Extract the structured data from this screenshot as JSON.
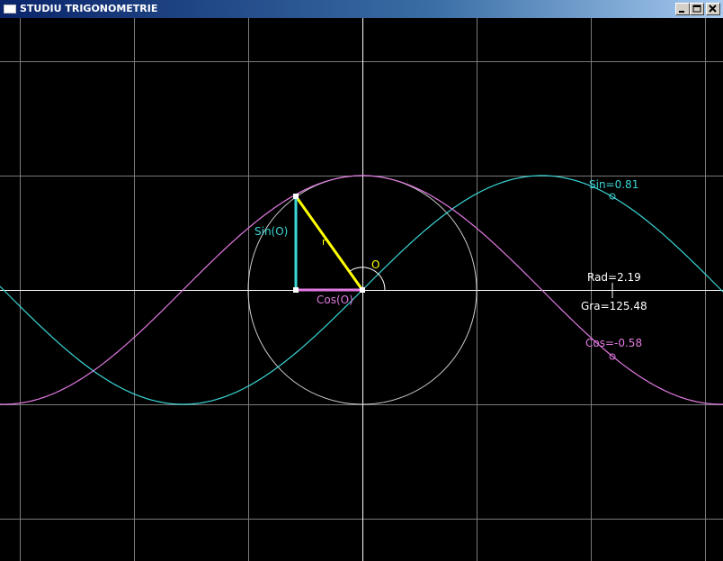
{
  "window": {
    "title": "STUDIU TRIGONOMETRIE"
  },
  "colors": {
    "sin": "#3cd6d6",
    "cos": "#e27ae2",
    "radius": "#ffff00",
    "axes": "#ffffff",
    "grid": "#7a7a7a",
    "circle": "#d0d0d0"
  },
  "labels": {
    "sin_value": "Sin=0.81",
    "cos_value": "Cos=-0.58",
    "rad": "Rad=2.19",
    "gra": "Gra=125.48",
    "sin_o": "Sin(O)",
    "cos_o": "Cos(O)",
    "radius_r": "r",
    "angle_o": "O"
  },
  "state": {
    "angle_rad": 2.19,
    "angle_deg": 125.48,
    "sin": 0.81,
    "cos": -0.58
  }
}
